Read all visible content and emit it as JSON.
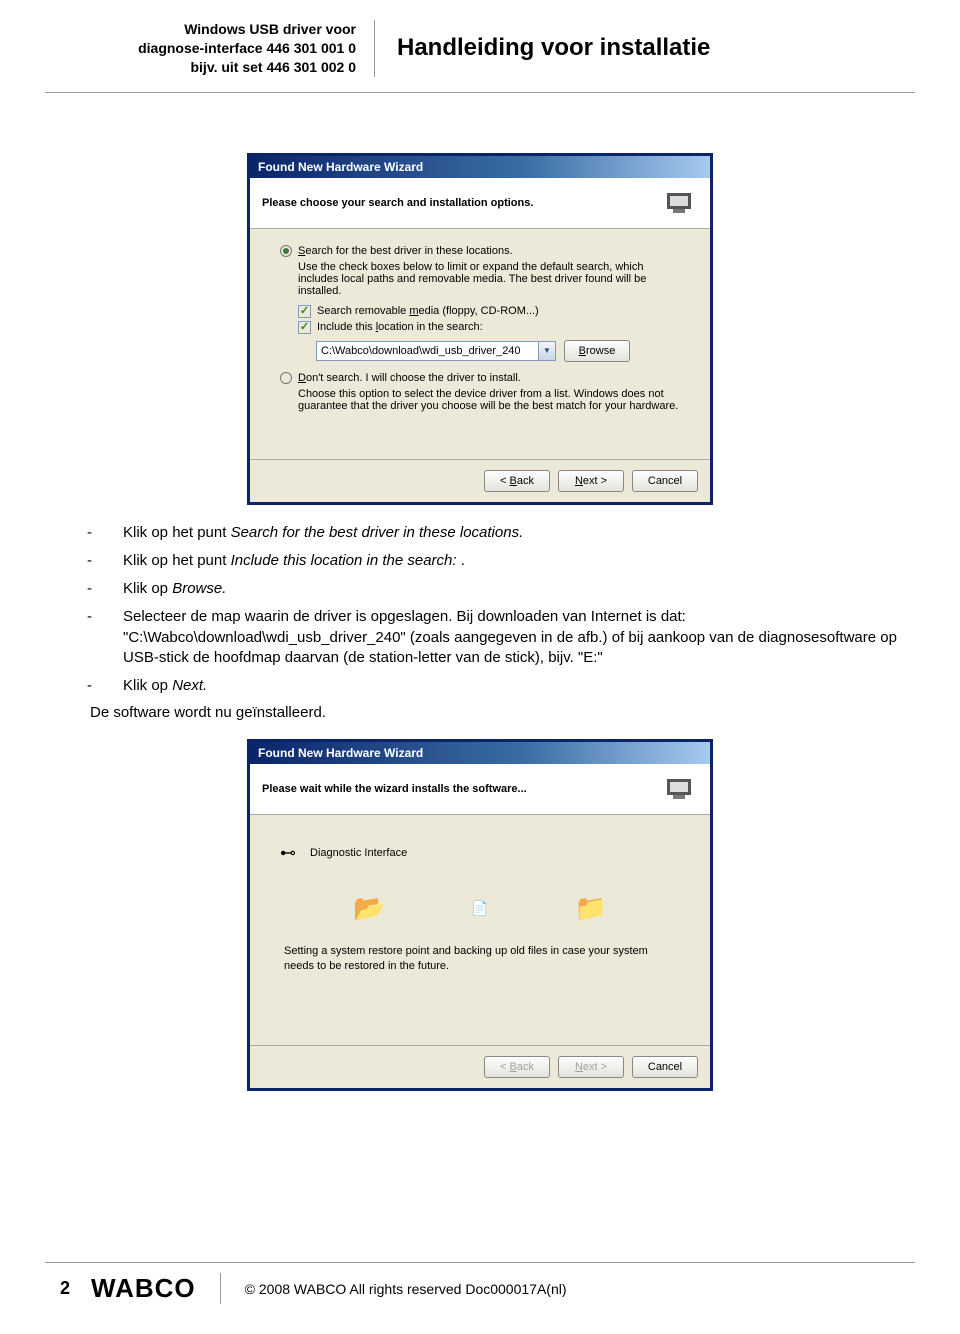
{
  "header": {
    "left_line1": "Windows USB driver voor",
    "left_line2": "diagnose-interface 446 301 001 0",
    "left_line3": "bijv. uit  set 446 301 002 0",
    "title": "Handleiding voor installatie"
  },
  "wizard1": {
    "title": "Found New Hardware Wizard",
    "head": "Please choose your search and installation options.",
    "opt1_pre": "S",
    "opt1_rest": "earch for the best driver in these locations.",
    "hint": "Use the check boxes below to limit or expand the default search, which includes local paths and removable media. The best driver found will be installed.",
    "chk1_pre": "Search removable ",
    "chk1_u": "m",
    "chk1_rest": "edia (floppy, CD-ROM...)",
    "chk2_pre": "Include this ",
    "chk2_u": "l",
    "chk2_rest": "ocation in the search:",
    "path": "C:\\Wabco\\download\\wdi_usb_driver_240",
    "browse_u": "B",
    "browse_rest": "rowse",
    "opt2_u": "D",
    "opt2_rest": "on't search. I will choose the driver to install.",
    "hint2": "Choose this option to select the device driver from a list.  Windows does not guarantee that the driver you choose will be the best match for your hardware.",
    "back_pre": "< ",
    "back_u": "B",
    "back_rest": "ack",
    "next_u": "N",
    "next_rest": "ext >",
    "cancel": "Cancel"
  },
  "steps": {
    "s1a": "Klik op het punt ",
    "s1b": "Search for the best driver in these locations.",
    "s2a": "Klik op het punt ",
    "s2b": "Include this location in the search:",
    "s2c": " .",
    "s3a": "Klik op ",
    "s3b": "Browse.",
    "s4": "Selecteer de map waarin de driver is opgeslagen. Bij downloaden van Internet is dat: \"C:\\Wabco\\download\\wdi_usb_driver_240\" (zoals aangegeven in de afb.) of bij aankoop van de diagnosesoftware op USB-stick de hoofdmap daarvan (de station-letter van de stick), bijv. \"E:\"",
    "s5a": "Klik op ",
    "s5b": "Next.",
    "after": "De software wordt nu geïnstalleerd."
  },
  "wizard2": {
    "title": "Found New Hardware Wizard",
    "head": "Please wait while the wizard installs the software...",
    "device": "Diagnostic Interface",
    "status": "Setting a system restore point and backing up old files in case your system needs to be restored in the future.",
    "back_pre": "< ",
    "back_u": "B",
    "back_rest": "ack",
    "next_u": "N",
    "next_rest": "ext >",
    "cancel": "Cancel"
  },
  "footer": {
    "page": "2",
    "logo": "WABCO",
    "copy": "© 2008 WABCO All rights reserved Doc000017A(nl)"
  }
}
